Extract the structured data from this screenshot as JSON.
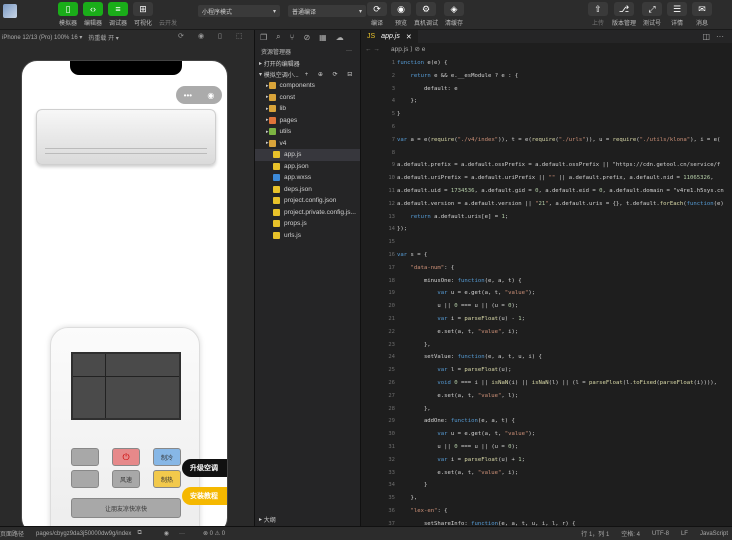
{
  "toolbar": {
    "left": [
      {
        "label": "模拟器",
        "icon": "phone-icon"
      },
      {
        "label": "编辑器",
        "icon": "code-icon"
      },
      {
        "label": "调试器",
        "icon": "debug-icon"
      },
      {
        "label": "可视化",
        "icon": "visual-icon"
      },
      {
        "label": "云开发",
        "icon": "cloud-icon"
      }
    ],
    "mode_select": "小程序模式",
    "compile_select": "普通编译",
    "mid": [
      {
        "label": "编译"
      },
      {
        "label": "预览"
      },
      {
        "label": "真机调试"
      },
      {
        "label": "清缓存"
      }
    ],
    "right": [
      {
        "label": "上传"
      },
      {
        "label": "版本管理"
      },
      {
        "label": "测试号"
      },
      {
        "label": "详情"
      },
      {
        "label": "消息"
      }
    ]
  },
  "simulator": {
    "device": "iPhone 12/13 (Pro) 100% 16 ▾",
    "hot_reload": "热重载 开 ▾",
    "remote": {
      "btn_minus": "",
      "btn_power": "⏻",
      "btn_cool": "制冷",
      "btn_blank2": "",
      "btn_wind": "风速",
      "btn_heat": "制热",
      "share": "让朋友凉快凉快",
      "upgrade": "升级空调",
      "tutorial": "安装教程"
    }
  },
  "explorer": {
    "title": "资源管理器",
    "open_editors": "打开的编辑器",
    "project": "模拟空调小...",
    "items": [
      {
        "label": "components",
        "type": "folder",
        "color": "#d9a43a"
      },
      {
        "label": "const",
        "type": "folder",
        "color": "#d9a43a"
      },
      {
        "label": "lib",
        "type": "folder",
        "color": "#d9a43a"
      },
      {
        "label": "pages",
        "type": "folder",
        "color": "#e0743a"
      },
      {
        "label": "utils",
        "type": "folder",
        "color": "#7cb342"
      },
      {
        "label": "v4",
        "type": "folder",
        "color": "#d9a43a"
      },
      {
        "label": "app.js",
        "type": "file",
        "color": "#e8c22a"
      },
      {
        "label": "app.json",
        "type": "file",
        "color": "#e8c22a"
      },
      {
        "label": "app.wxss",
        "type": "file",
        "color": "#3c8ad9"
      },
      {
        "label": "deps.json",
        "type": "file",
        "color": "#e8c22a"
      },
      {
        "label": "project.config.json",
        "type": "file",
        "color": "#e8c22a"
      },
      {
        "label": "project.private.config.js...",
        "type": "file",
        "color": "#e8c22a"
      },
      {
        "label": "props.js",
        "type": "file",
        "color": "#e8c22a"
      },
      {
        "label": "urls.js",
        "type": "file",
        "color": "#e8c22a"
      }
    ],
    "outline": "大纲"
  },
  "editor": {
    "tab": "app.js",
    "breadcrumb": "app.js  ⟩ ⊘ e",
    "code": [
      "function e(e) {",
      "    return e && e.__esModule ? e : {",
      "        default: e",
      "    };",
      "}",
      "",
      "var a = e(require(\"./v4/index\")), t = e(require(\"./urls\")), u = require(\"./utils/klona\"), i = e(",
      "",
      "a.default.prefix = a.default.ossPrefix = a.default.ossPrefix || \"https://cdn.getool.cn/service/f",
      "a.default.uriPrefix = a.default.uriPrefix || \"\" || a.default.prefix, a.default.nid = 11065326,",
      "a.default.uid = 1734536, a.default.gid = 0, a.default.eid = 0, a.default.domain = \"v4re1.h5sys.cn",
      "a.default.version = a.default.version || \"21\", a.default.uris = {}, t.default.forEach(function(e)",
      "    return a.default.uris[e] = 1;",
      "});",
      "",
      "var s = {",
      "    \"data-num\": {",
      "        minusOne: function(e, a, t) {",
      "            var u = e.get(a, t, \"value\");",
      "            u || 0 === u || (u = 0);",
      "            var i = parseFloat(u) - 1;",
      "            e.set(a, t, \"value\", i);",
      "        },",
      "        setValue: function(e, a, t, u, i) {",
      "            var l = parseFloat(u);",
      "            void 0 === i || isNaN(i) || isNaN(l) || (l = parseFloat(l.toFixed(parseFloat(i)))),",
      "            e.set(a, t, \"value\", l);",
      "        },",
      "        addOne: function(e, a, t) {",
      "            var u = e.get(a, t, \"value\");",
      "            u || 0 === u || (u = 0);",
      "            var i = parseFloat(u) + 1;",
      "            e.set(a, t, \"value\", i);",
      "        }",
      "    },",
      "    \"lex-en\": {",
      "        setShareInfo: function(e, a, t, u, i, l, r) {"
    ]
  },
  "status": {
    "path_label": "页面路径",
    "path": "pages/cbygz9da3j50000dw9g/index",
    "errors": "⊗ 0 ⚠ 0",
    "position": "行 1，列 1",
    "spaces": "空格: 4",
    "encoding": "UTF-8",
    "eol": "LF",
    "language": "JavaScript"
  }
}
